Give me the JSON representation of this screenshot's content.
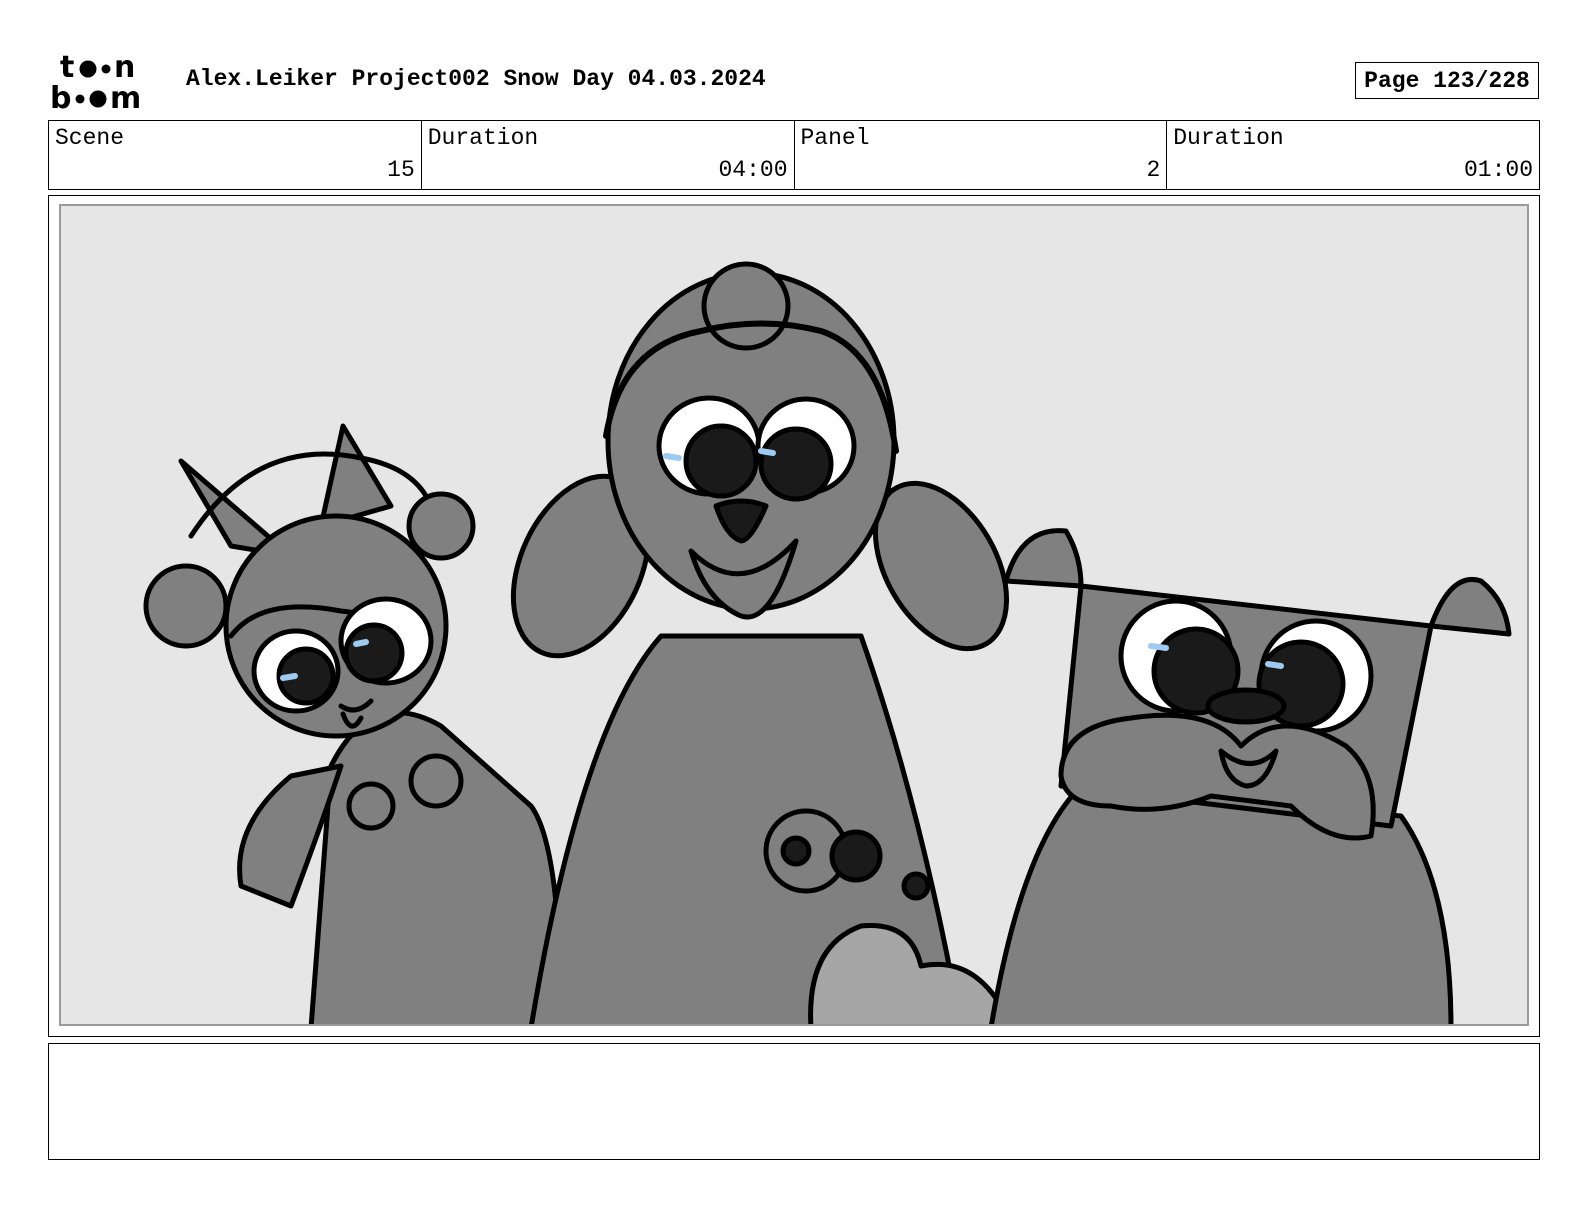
{
  "header": {
    "logo_name": "toon boom",
    "title": "Alex.Leiker Project002 Snow Day 04.03.2024",
    "page": "Page 123/228"
  },
  "info": {
    "scene_label": "Scene",
    "scene_value": "15",
    "scene_duration_label": "Duration",
    "scene_duration_value": "04:00",
    "panel_label": "Panel",
    "panel_value": "2",
    "panel_duration_label": "Duration",
    "panel_duration_value": "01:00"
  },
  "notes": {
    "text": ""
  },
  "colors": {
    "panel_bg": "#e6e6e6",
    "character_fill": "#808080",
    "accent_fill": "#a6a6a6",
    "eye_highlight": "#9ec9f0"
  }
}
